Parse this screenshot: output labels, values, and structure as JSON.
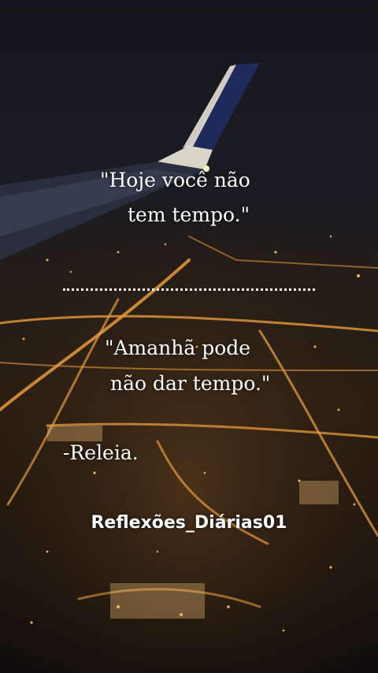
{
  "quote": {
    "line1": "\"Hoje você não",
    "line2": "tem tempo.\"",
    "line3": "\"Amanhã pode",
    "line4": "não dar tempo.\""
  },
  "author": "-Releia.",
  "handle": "Reflexões_Diárias01",
  "colors": {
    "text": "#ffffff",
    "city_lights": "#f0a040",
    "sky": "#15161c"
  }
}
